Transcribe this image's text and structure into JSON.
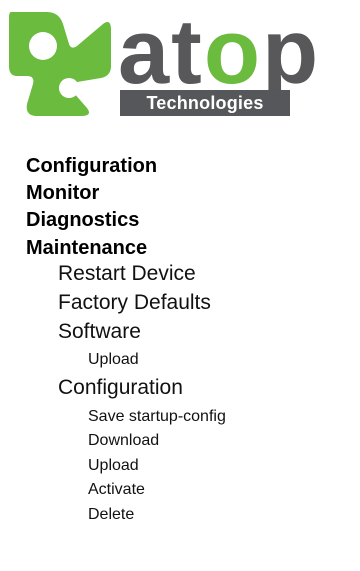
{
  "logo": {
    "wordmark_a": "a",
    "wordmark_t": "t",
    "wordmark_o": "o",
    "wordmark_p": "p",
    "subtitle": "Technologies",
    "brand_green": "#6abb3e",
    "brand_gray": "#58585a"
  },
  "nav": {
    "configuration": "Configuration",
    "monitor": "Monitor",
    "diagnostics": "Diagnostics",
    "maintenance": "Maintenance",
    "restart_device": "Restart Device",
    "factory_defaults": "Factory Defaults",
    "software": "Software",
    "software_upload": "Upload",
    "config_sub": "Configuration",
    "save_startup_config": "Save startup-config",
    "download": "Download",
    "config_upload": "Upload",
    "activate": "Activate",
    "delete": "Delete"
  }
}
